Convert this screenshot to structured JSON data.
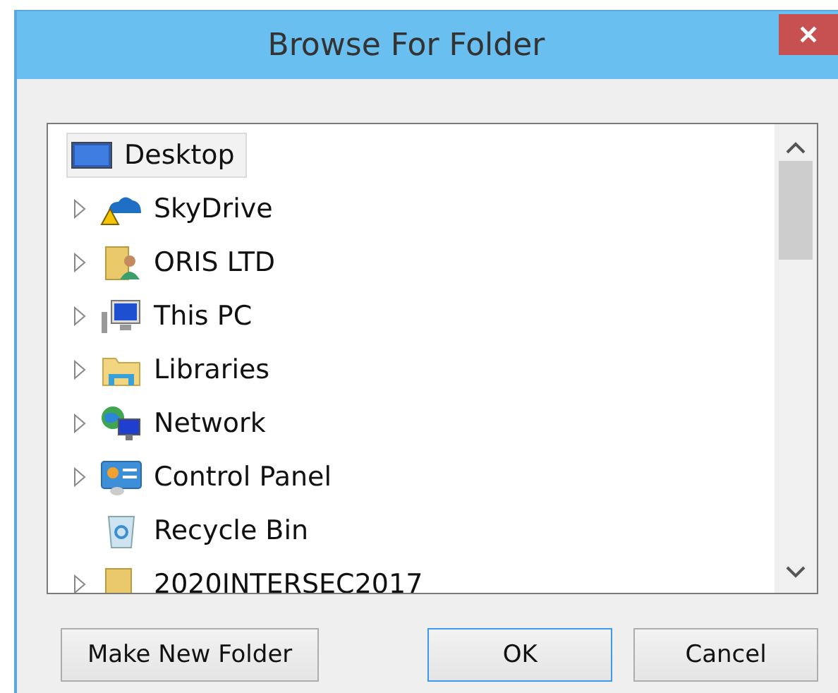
{
  "window": {
    "title": "Browse For Folder",
    "close": "✕"
  },
  "tree": {
    "root": {
      "label": "Desktop",
      "kind": "desktop",
      "selected": true,
      "children": [
        {
          "label": "SkyDrive",
          "kind": "cloud",
          "expandable": true,
          "selected": false
        },
        {
          "label": "ORIS LTD",
          "kind": "user-folder",
          "expandable": true,
          "selected": false
        },
        {
          "label": "This PC",
          "kind": "computer",
          "expandable": true,
          "selected": false
        },
        {
          "label": "Libraries",
          "kind": "library",
          "expandable": true,
          "selected": false
        },
        {
          "label": "Network",
          "kind": "network",
          "expandable": true,
          "selected": false
        },
        {
          "label": "Control Panel",
          "kind": "control-panel",
          "expandable": true,
          "selected": false
        },
        {
          "label": "Recycle Bin",
          "kind": "recycle-bin",
          "expandable": false,
          "selected": false
        },
        {
          "label": "2020INTERSEC2017",
          "kind": "folder",
          "expandable": true,
          "selected": false
        }
      ]
    }
  },
  "buttons": [
    {
      "label": "Make New Folder",
      "default": false
    },
    {
      "label": "OK",
      "default": true
    },
    {
      "label": "Cancel",
      "default": false
    }
  ]
}
